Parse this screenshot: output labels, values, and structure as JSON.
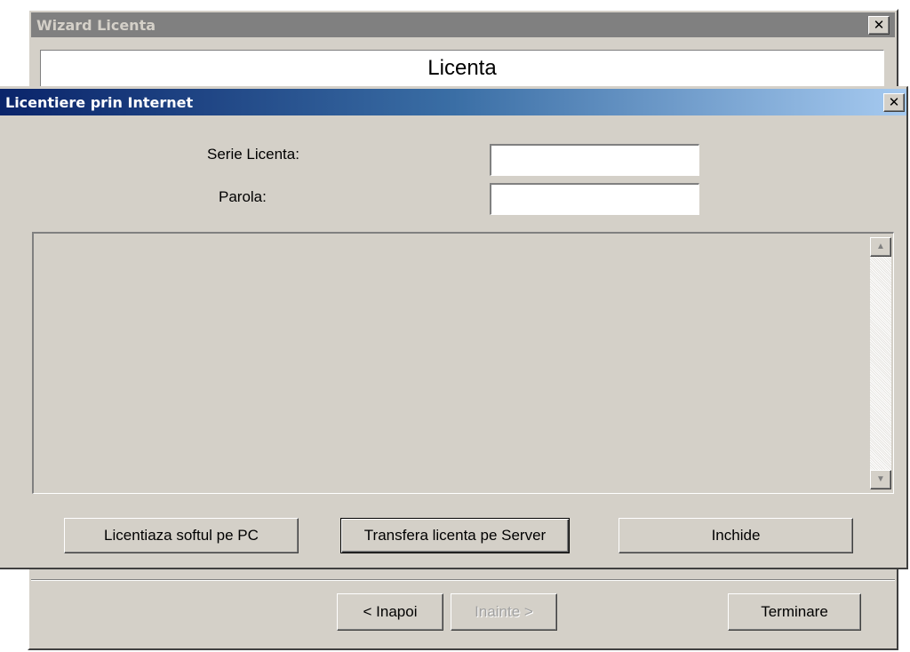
{
  "wizard": {
    "title": "Wizard Licenta",
    "close_glyph": "✕",
    "heading": "Licenta",
    "buttons": {
      "back": "< Inapoi",
      "next": "Inainte >",
      "finish": "Terminare"
    }
  },
  "dialog": {
    "title": "Licentiere prin Internet",
    "close_glyph": "✕",
    "serial_label": "Serie Licenta:",
    "serial_value": "",
    "password_label": "Parola:",
    "password_value": "",
    "memo_text": "",
    "scroll_up_icon": "up-arrow-icon",
    "scroll_down_icon": "down-arrow-icon",
    "buttons": {
      "license_pc": "Licentiaza softul pe PC",
      "transfer_server": "Transfera licenta pe Server",
      "close": "Inchide"
    }
  },
  "colors": {
    "face": "#d4d0c8",
    "active_title_start": "#0a246a",
    "active_title_end": "#a6caf0",
    "inactive_title": "#808080"
  }
}
